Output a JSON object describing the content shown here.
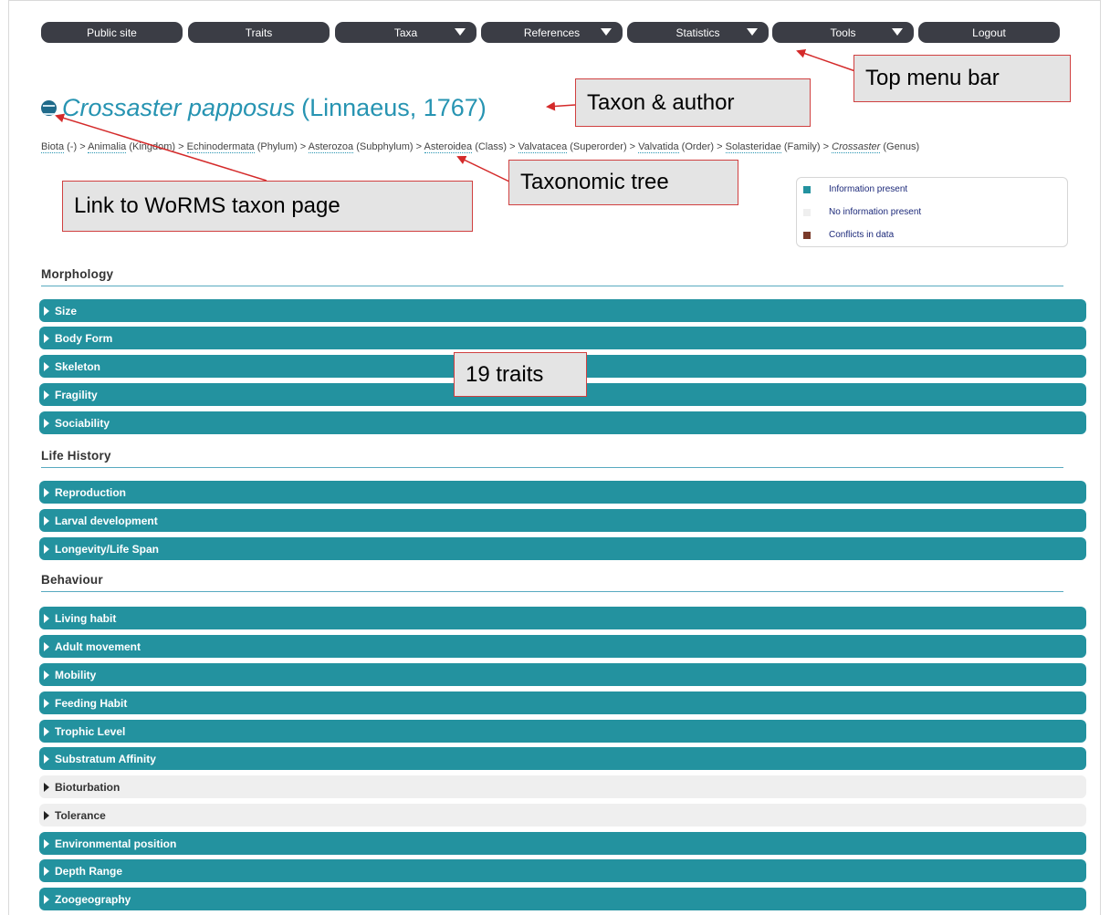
{
  "menu": [
    {
      "label": "Public site",
      "dropdown": false
    },
    {
      "label": "Traits",
      "dropdown": false
    },
    {
      "label": "Taxa",
      "dropdown": true
    },
    {
      "label": "References",
      "dropdown": true
    },
    {
      "label": "Statistics",
      "dropdown": true
    },
    {
      "label": "Tools",
      "dropdown": true
    },
    {
      "label": "Logout",
      "dropdown": false
    }
  ],
  "taxon": {
    "name": "Crossaster papposus",
    "author": "(Linnaeus, 1767)",
    "icon": "worms-globe-icon"
  },
  "breadcrumb": [
    {
      "name": "Biota",
      "rank": "(-)"
    },
    {
      "name": "Animalia",
      "rank": "(Kingdom)"
    },
    {
      "name": "Echinodermata",
      "rank": "(Phylum)"
    },
    {
      "name": "Asterozoa",
      "rank": "(Subphylum)"
    },
    {
      "name": "Asteroidea",
      "rank": "(Class)"
    },
    {
      "name": "Valvatacea",
      "rank": "(Superorder)"
    },
    {
      "name": "Valvatida",
      "rank": "(Order)"
    },
    {
      "name": "Solasteridae",
      "rank": "(Family)"
    },
    {
      "name": "Crossaster",
      "rank": "(Genus)"
    }
  ],
  "legend": [
    {
      "label": "Information present",
      "color": "#23929f"
    },
    {
      "label": "No information present",
      "color": "#efefef"
    },
    {
      "label": "Conflicts in data",
      "color": "#7a3a2a"
    }
  ],
  "sections": [
    {
      "title": "Morphology",
      "traits": [
        {
          "label": "Size",
          "info": true
        },
        {
          "label": "Body Form",
          "info": true
        },
        {
          "label": "Skeleton",
          "info": true
        },
        {
          "label": "Fragility",
          "info": true
        },
        {
          "label": "Sociability",
          "info": true
        }
      ]
    },
    {
      "title": "Life History",
      "traits": [
        {
          "label": "Reproduction",
          "info": true
        },
        {
          "label": "Larval development",
          "info": true
        },
        {
          "label": "Longevity/Life Span",
          "info": true
        }
      ]
    },
    {
      "title": "Behaviour",
      "traits": [
        {
          "label": "Living habit",
          "info": true
        },
        {
          "label": "Adult movement",
          "info": true
        },
        {
          "label": "Mobility",
          "info": true
        },
        {
          "label": "Feeding Habit",
          "info": true
        },
        {
          "label": "Trophic Level",
          "info": true
        },
        {
          "label": "Substratum Affinity",
          "info": true
        },
        {
          "label": "Bioturbation",
          "info": false
        },
        {
          "label": "Tolerance",
          "info": false
        },
        {
          "label": "Environmental position",
          "info": true
        },
        {
          "label": "Depth Range",
          "info": true
        },
        {
          "label": "Zoogeography",
          "info": true
        }
      ]
    }
  ],
  "annotations": {
    "top_menu": "Top menu bar",
    "taxon_author": "Taxon & author",
    "tree": "Taxonomic tree",
    "worms_link": "Link to WoRMS taxon page",
    "traits_count": "19 traits"
  }
}
